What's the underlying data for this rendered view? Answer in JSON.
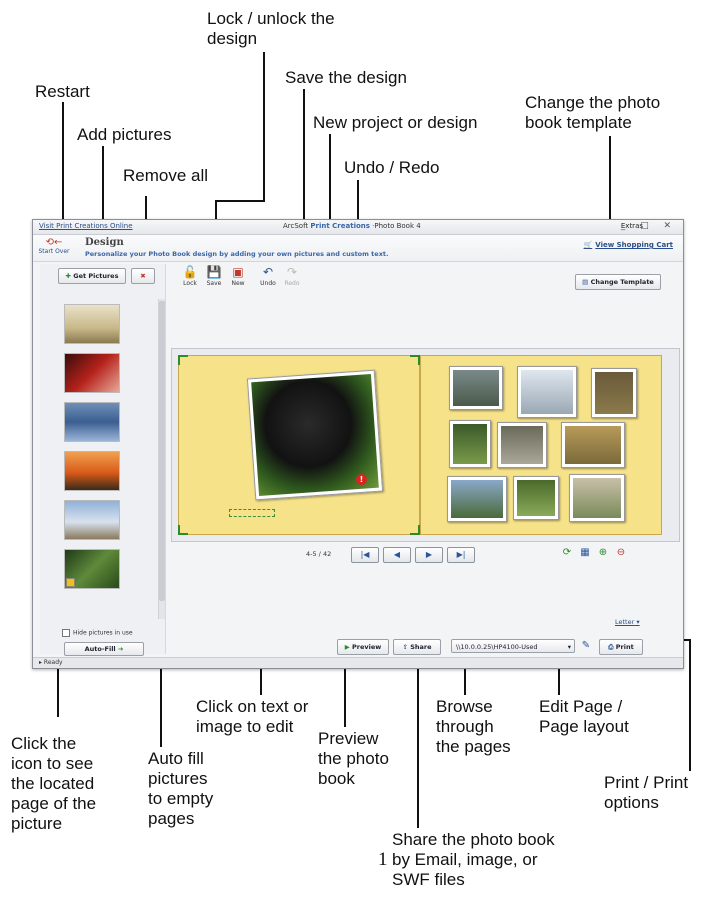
{
  "callouts": {
    "restart": "Restart",
    "add_pictures": "Add pictures",
    "remove_all": "Remove all",
    "lock_unlock": "Lock / unlock the\ndesign",
    "save_design": "Save the design",
    "new_project": "New project or design",
    "undo_redo": "Undo / Redo",
    "change_template": "Change the photo\nbook template",
    "click_edit": "Click on text or\nimage to edit",
    "browse": "Browse\nthrough\nthe pages",
    "edit_page": "Edit Page /\nPage layout",
    "click_icon": "Click the\nicon to see\nthe located\npage of the\npicture",
    "auto_fill": "Auto fill\npictures\nto empty\npages",
    "preview": "Preview\nthe photo\nbook",
    "print_options": "Print / Print\noptions",
    "share": "Share the photo book\nby Email, image, or\nSWF files",
    "page_number": "1"
  },
  "app": {
    "window_link": "Visit Print Creations Online",
    "title_prefix": "ArcSoft",
    "title_brand": "Print Creations",
    "title_suffix": "·Photo Book 4",
    "extras": "Extras",
    "start_over": "Start Over",
    "section_title": "Design",
    "section_subtitle": "Personalize your Photo Book design by adding your own pictures and custom text.",
    "view_cart": "View Shopping Cart",
    "get_pictures": "Get Pictures",
    "hide_pictures": "Hide pictures in use",
    "auto_fill": "Auto-Fill",
    "tools": {
      "lock": "Lock",
      "save": "Save",
      "new": "New",
      "undo": "Undo",
      "redo": "Redo"
    },
    "change_template": "Change Template",
    "page_indicator": "4-5 / 42",
    "letter": "Letter",
    "preview": "Preview",
    "share": "Share",
    "printer": "\\\\10.0.0.25\\HP4100-Used",
    "print": "Print",
    "status": "Ready"
  }
}
